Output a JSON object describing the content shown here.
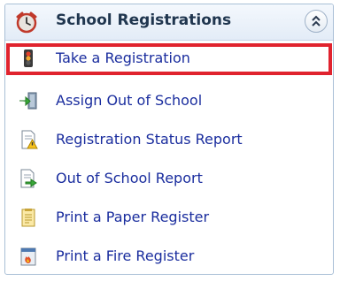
{
  "panel": {
    "title": "School Registrations",
    "header_icon": "alarm-clock-icon",
    "collapse_icon": "double-chevron-up-icon"
  },
  "items": [
    {
      "label": "Take a Registration",
      "icon": "traffic-light-icon",
      "selected": true
    },
    {
      "label": "Assign Out of School",
      "icon": "door-exit-arrow-icon",
      "selected": false
    },
    {
      "label": "Registration Status Report",
      "icon": "report-warning-icon",
      "selected": false
    },
    {
      "label": "Out of School Report",
      "icon": "report-arrow-icon",
      "selected": false
    },
    {
      "label": "Print a Paper Register",
      "icon": "paper-register-icon",
      "selected": false
    },
    {
      "label": "Print a Fire Register",
      "icon": "fire-register-icon",
      "selected": false
    }
  ],
  "colors": {
    "selection_border": "#e0232e",
    "link_text": "#1a2d9e",
    "header_text": "#20364f"
  }
}
